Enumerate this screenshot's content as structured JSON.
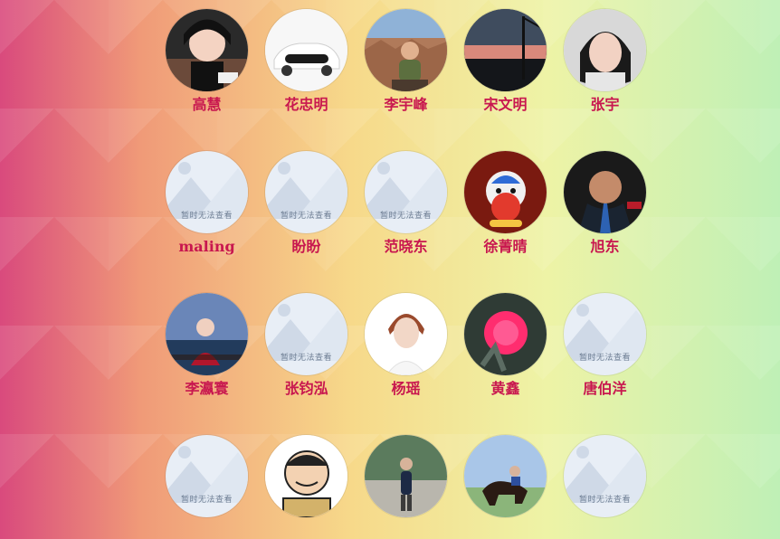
{
  "people": [
    {
      "name": "高慧",
      "avatar": "photo-girl"
    },
    {
      "name": "花忠明",
      "avatar": "photo-car"
    },
    {
      "name": "李宇峰",
      "avatar": "photo-canyon"
    },
    {
      "name": "宋文明",
      "avatar": "photo-sunset"
    },
    {
      "name": "张宇",
      "avatar": "photo-woman"
    },
    {
      "name": "maling",
      "avatar": "placeholder",
      "placeholder_text": "暂时无法查看"
    },
    {
      "name": "盼盼",
      "avatar": "placeholder",
      "placeholder_text": "暂时无法查看"
    },
    {
      "name": "范晓东",
      "avatar": "placeholder",
      "placeholder_text": "暂时无法查看"
    },
    {
      "name": "徐菁晴",
      "avatar": "photo-toy"
    },
    {
      "name": "旭东",
      "avatar": "photo-man-suit"
    },
    {
      "name": "李瀛寰",
      "avatar": "photo-lake"
    },
    {
      "name": "张钧泓",
      "avatar": "placeholder",
      "placeholder_text": "暂时无法查看"
    },
    {
      "name": "杨瑶",
      "avatar": "photo-portrait"
    },
    {
      "name": "黄鑫",
      "avatar": "photo-flower"
    },
    {
      "name": "唐伯洋",
      "avatar": "placeholder",
      "placeholder_text": "暂时无法查看"
    },
    {
      "name": "",
      "avatar": "placeholder",
      "placeholder_text": "暂时无法查看"
    },
    {
      "name": "",
      "avatar": "photo-cartoon"
    },
    {
      "name": "",
      "avatar": "photo-steps"
    },
    {
      "name": "",
      "avatar": "photo-horse"
    },
    {
      "name": "",
      "avatar": "placeholder",
      "placeholder_text": "暂时无法查看"
    }
  ],
  "colors": {
    "name_text": "#c8174f",
    "bg_left": "#d94a7d",
    "bg_mid": "#f7d98a",
    "bg_right": "#bff0b6"
  }
}
